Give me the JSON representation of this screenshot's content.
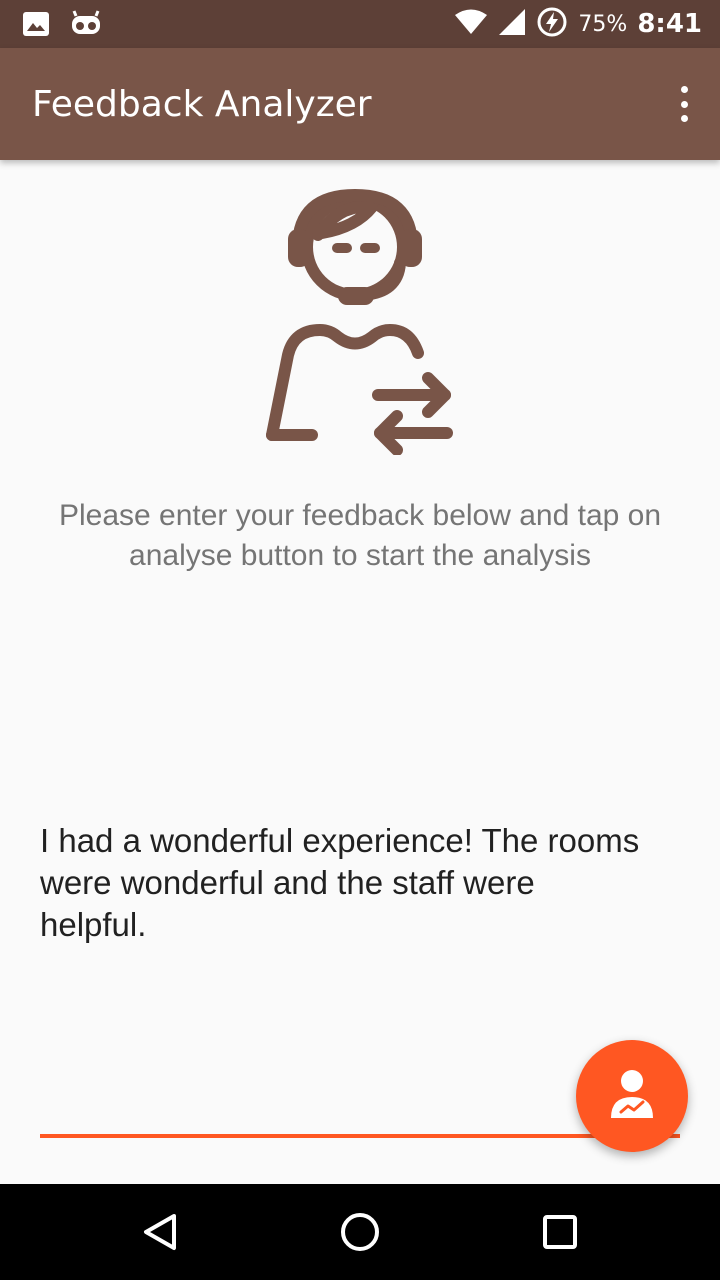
{
  "status_bar": {
    "icons_left": [
      "image-icon",
      "voicemail-icon"
    ],
    "icons_right": [
      "wifi-icon",
      "signal-icon",
      "battery-charging-icon"
    ],
    "battery_percent": "75%",
    "time": "8:41"
  },
  "app_bar": {
    "title": "Feedback Analyzer",
    "menu_icon": "more-vert-icon"
  },
  "main": {
    "hero_icon": "support-agent-exchange-icon",
    "instruction": "Please enter your feedback below and tap on analyse button to start the analysis",
    "feedback_text": "I had a wonderful experience! The rooms were wonderful and the staff were helpful."
  },
  "fab": {
    "icon": "analyst-person-icon"
  },
  "nav_bar": {
    "icons": [
      "back-icon",
      "home-icon",
      "recents-icon"
    ]
  },
  "colors": {
    "status_bar": "#5d4037",
    "app_bar": "#795548",
    "accent": "#ff5722",
    "icon_brown": "#795548"
  }
}
